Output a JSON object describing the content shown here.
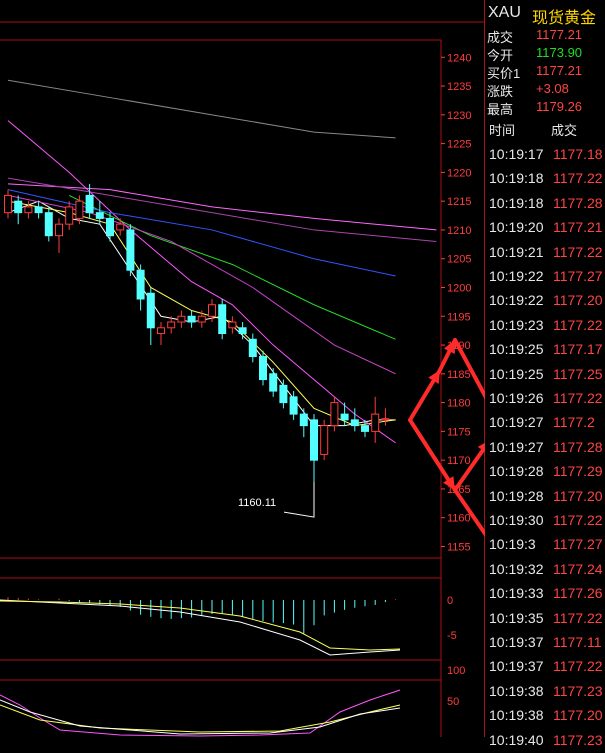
{
  "header": {
    "symbol": "XAU",
    "name": "现货黄金"
  },
  "quote": [
    {
      "label": "成交",
      "value": "1177.21",
      "color": "#ff4444"
    },
    {
      "label": "今开",
      "value": "1173.90",
      "color": "#22dd22"
    },
    {
      "label": "买价1",
      "value": "1177.21",
      "color": "#ff4444"
    },
    {
      "label": "涨跌",
      "value": "+3.08",
      "color": "#ff4444"
    },
    {
      "label": "最高",
      "value": "1179.26",
      "color": "#ff4444"
    }
  ],
  "ticks_header": {
    "time": "时间",
    "price": "成交"
  },
  "ticks": [
    {
      "time": "10:19:17",
      "price": "1177.18"
    },
    {
      "time": "10:19:18",
      "price": "1177.22"
    },
    {
      "time": "10:19:18",
      "price": "1177.28"
    },
    {
      "time": "10:19:20",
      "price": "1177.21"
    },
    {
      "time": "10:19:21",
      "price": "1177.22"
    },
    {
      "time": "10:19:22",
      "price": "1177.27"
    },
    {
      "time": "10:19:22",
      "price": "1177.20"
    },
    {
      "time": "10:19:23",
      "price": "1177.22"
    },
    {
      "time": "10:19:25",
      "price": "1177.17"
    },
    {
      "time": "10:19:25",
      "price": "1177.25"
    },
    {
      "time": "10:19:26",
      "price": "1177.22"
    },
    {
      "time": "10:19:27",
      "price": "1177.2"
    },
    {
      "time": "10:19:27",
      "price": "1177.28"
    },
    {
      "time": "10:19:28",
      "price": "1177.29"
    },
    {
      "time": "10:19:28",
      "price": "1177.20"
    },
    {
      "time": "10:19:30",
      "price": "1177.22"
    },
    {
      "time": "10:19:3",
      "price": "1177.27"
    },
    {
      "time": "10:19:32",
      "price": "1177.24"
    },
    {
      "time": "10:19:33",
      "price": "1177.26"
    },
    {
      "time": "10:19:35",
      "price": "1177.22"
    },
    {
      "time": "10:19:37",
      "price": "1177.11"
    },
    {
      "time": "10:19:37",
      "price": "1177.22"
    },
    {
      "time": "10:19:38",
      "price": "1177.23"
    },
    {
      "time": "10:19:38",
      "price": "1177.20"
    },
    {
      "time": "10:19:40",
      "price": "1177.23"
    }
  ],
  "chart_data": {
    "type": "candlestick",
    "ylim": [
      1153,
      1243
    ],
    "y_ticks": [
      1240,
      1235,
      1230,
      1225,
      1220,
      1215,
      1210,
      1205,
      1200,
      1195,
      1190,
      1185,
      1180,
      1175,
      1170,
      1165,
      1160,
      1155
    ],
    "annotation": {
      "text": "1160.11",
      "value": 1160.11
    },
    "candles": [
      {
        "o": 1213,
        "c": 1216,
        "h": 1217,
        "l": 1212
      },
      {
        "o": 1215,
        "c": 1213,
        "h": 1216,
        "l": 1211
      },
      {
        "o": 1213,
        "c": 1214,
        "h": 1215,
        "l": 1212
      },
      {
        "o": 1214,
        "c": 1213,
        "h": 1215,
        "l": 1212
      },
      {
        "o": 1213,
        "c": 1209,
        "h": 1214,
        "l": 1208
      },
      {
        "o": 1209,
        "c": 1211,
        "h": 1212,
        "l": 1206
      },
      {
        "o": 1211,
        "c": 1214,
        "h": 1215,
        "l": 1210
      },
      {
        "o": 1212,
        "c": 1215,
        "h": 1216,
        "l": 1211
      },
      {
        "o": 1216,
        "c": 1213,
        "h": 1218,
        "l": 1212
      },
      {
        "o": 1213,
        "c": 1212,
        "h": 1215,
        "l": 1211
      },
      {
        "o": 1212,
        "c": 1209,
        "h": 1213,
        "l": 1208
      },
      {
        "o": 1210,
        "c": 1211,
        "h": 1212,
        "l": 1209
      },
      {
        "o": 1210,
        "c": 1203,
        "h": 1211,
        "l": 1202
      },
      {
        "o": 1203,
        "c": 1198,
        "h": 1204,
        "l": 1196
      },
      {
        "o": 1199,
        "c": 1193,
        "h": 1200,
        "l": 1190
      },
      {
        "o": 1192,
        "c": 1193,
        "h": 1194,
        "l": 1190
      },
      {
        "o": 1193,
        "c": 1194,
        "h": 1195,
        "l": 1192
      },
      {
        "o": 1194,
        "c": 1195,
        "h": 1196,
        "l": 1193
      },
      {
        "o": 1195,
        "c": 1194,
        "h": 1196,
        "l": 1193
      },
      {
        "o": 1194,
        "c": 1195,
        "h": 1196,
        "l": 1193
      },
      {
        "o": 1195,
        "c": 1197,
        "h": 1198,
        "l": 1194
      },
      {
        "o": 1197,
        "c": 1192,
        "h": 1198,
        "l": 1191
      },
      {
        "o": 1193,
        "c": 1194,
        "h": 1195,
        "l": 1192
      },
      {
        "o": 1193,
        "c": 1192,
        "h": 1194,
        "l": 1191
      },
      {
        "o": 1191,
        "c": 1188,
        "h": 1192,
        "l": 1187
      },
      {
        "o": 1188,
        "c": 1184,
        "h": 1189,
        "l": 1183
      },
      {
        "o": 1185,
        "c": 1182,
        "h": 1186,
        "l": 1181
      },
      {
        "o": 1183,
        "c": 1180,
        "h": 1184,
        "l": 1179
      },
      {
        "o": 1181,
        "c": 1178,
        "h": 1182,
        "l": 1177
      },
      {
        "o": 1178,
        "c": 1176,
        "h": 1179,
        "l": 1174
      },
      {
        "o": 1177,
        "c": 1170,
        "h": 1178,
        "l": 1160.11
      },
      {
        "o": 1171,
        "c": 1176,
        "h": 1177,
        "l": 1170
      },
      {
        "o": 1176,
        "c": 1180,
        "h": 1181,
        "l": 1175
      },
      {
        "o": 1178,
        "c": 1177,
        "h": 1180,
        "l": 1176
      },
      {
        "o": 1177,
        "c": 1176,
        "h": 1179,
        "l": 1175
      },
      {
        "o": 1176,
        "c": 1175,
        "h": 1177,
        "l": 1174
      },
      {
        "o": 1175,
        "c": 1178,
        "h": 1181,
        "l": 1173
      },
      {
        "o": 1177,
        "c": 1177.2,
        "h": 1179,
        "l": 1176
      }
    ],
    "moving_averages": [
      {
        "color": "#ffffff",
        "values": [
          [
            0,
            1213
          ],
          [
            3,
            1215
          ],
          [
            6,
            1212
          ],
          [
            9,
            1211
          ],
          [
            12,
            1203
          ],
          [
            15,
            1195
          ],
          [
            18,
            1194
          ],
          [
            21,
            1195
          ],
          [
            24,
            1190
          ],
          [
            27,
            1183
          ],
          [
            30,
            1176
          ],
          [
            33,
            1176
          ],
          [
            36,
            1177
          ],
          [
            38,
            1177
          ]
        ]
      },
      {
        "color": "#ffff55",
        "values": [
          [
            0,
            1215
          ],
          [
            6,
            1213
          ],
          [
            10,
            1211
          ],
          [
            14,
            1200
          ],
          [
            18,
            1196
          ],
          [
            22,
            1194
          ],
          [
            26,
            1187
          ],
          [
            30,
            1179
          ],
          [
            34,
            1176
          ],
          [
            38,
            1177
          ]
        ]
      },
      {
        "color": "#ff55ff",
        "values": [
          [
            0,
            1229
          ],
          [
            6,
            1220
          ],
          [
            12,
            1210
          ],
          [
            18,
            1201
          ],
          [
            22,
            1197
          ],
          [
            26,
            1190
          ],
          [
            30,
            1184
          ],
          [
            34,
            1178
          ],
          [
            38,
            1173
          ]
        ]
      },
      {
        "color": "#22dd22",
        "values": [
          [
            6,
            1216
          ],
          [
            14,
            1209
          ],
          [
            22,
            1204
          ],
          [
            30,
            1197
          ],
          [
            38,
            1191
          ]
        ]
      },
      {
        "color": "#cc44cc",
        "values": [
          [
            0,
            1216
          ],
          [
            8,
            1213
          ],
          [
            16,
            1208
          ],
          [
            24,
            1200
          ],
          [
            32,
            1190
          ],
          [
            38,
            1185
          ]
        ]
      },
      {
        "color": "#3355ff",
        "values": [
          [
            0,
            1217
          ],
          [
            10,
            1213
          ],
          [
            20,
            1210
          ],
          [
            30,
            1205
          ],
          [
            38,
            1202
          ]
        ]
      },
      {
        "color": "#ff66ff",
        "values": [
          [
            0,
            1218
          ],
          [
            10,
            1217
          ],
          [
            20,
            1214
          ],
          [
            30,
            1212
          ],
          [
            42,
            1210
          ]
        ]
      },
      {
        "color": "#aa44aa",
        "values": [
          [
            0,
            1219
          ],
          [
            10,
            1216
          ],
          [
            20,
            1213
          ],
          [
            30,
            1210
          ],
          [
            42,
            1208
          ]
        ]
      },
      {
        "color": "#888888",
        "values": [
          [
            0,
            1236
          ],
          [
            10,
            1233
          ],
          [
            20,
            1230
          ],
          [
            30,
            1227
          ],
          [
            38,
            1226
          ]
        ]
      }
    ],
    "macd": {
      "y_ticks": [
        0,
        -5
      ],
      "histogram": [
        0.4,
        0.3,
        0.2,
        0.1,
        0,
        0.2,
        -0.1,
        -0.3,
        -0.4,
        -0.6,
        -0.8,
        -1,
        -1.5,
        -2.1,
        -2.4,
        -2.6,
        -2.7,
        -2.6,
        -2.5,
        -2.3,
        -2,
        -1.9,
        -2.1,
        -2.4,
        -2.7,
        -3.0,
        -3.2,
        -3.3,
        -3.5,
        -4.8,
        -3.6,
        -2.2,
        -1.8,
        -1.4,
        -1.1,
        -0.9,
        -0.7,
        -0.3,
        0.1
      ]
    },
    "kdj": {
      "y_ticks": [
        100,
        50
      ]
    },
    "forecast_arrows": "red zigzag arrows projecting price path"
  }
}
